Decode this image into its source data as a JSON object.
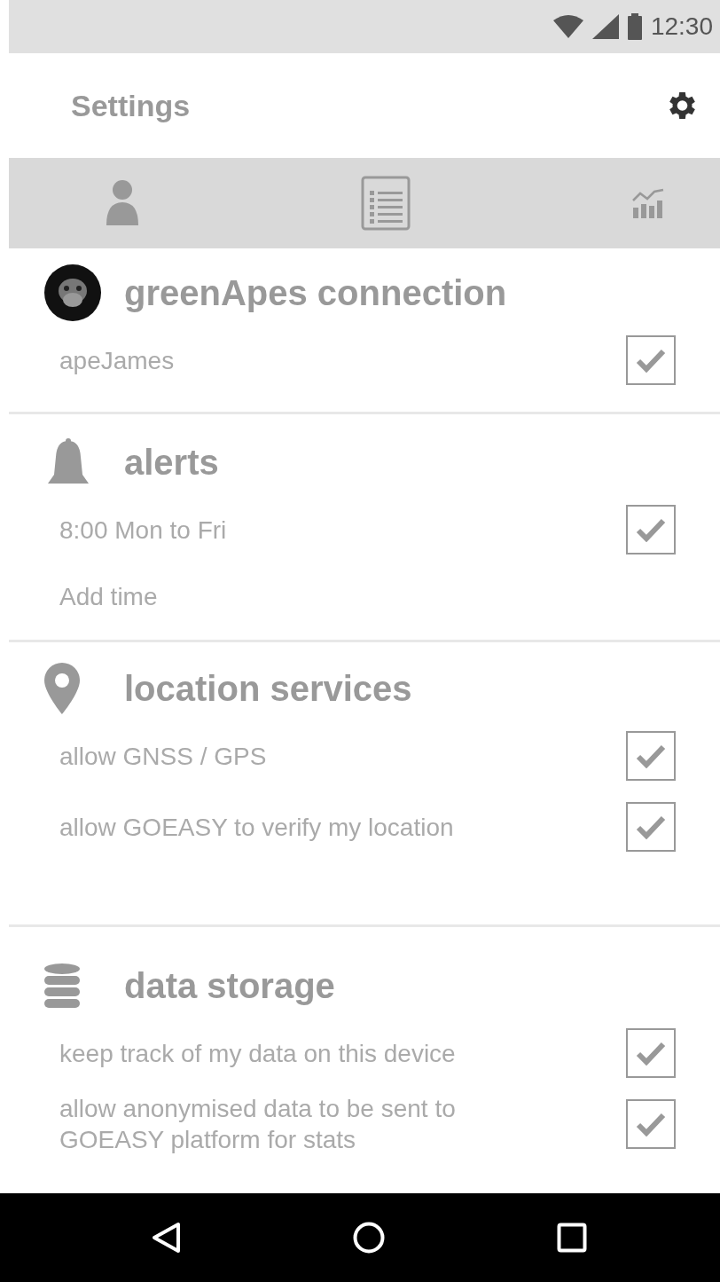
{
  "status_bar": {
    "time": "12:30"
  },
  "header": {
    "title": "Settings"
  },
  "sections": [
    {
      "title": "greenApes connection",
      "rows": [
        {
          "kind": "toggle",
          "text": "apeJames",
          "checked": true
        }
      ]
    },
    {
      "title": "alerts",
      "rows": [
        {
          "kind": "toggle",
          "text": "8:00 Mon to Fri",
          "checked": true
        },
        {
          "kind": "action",
          "text": "Add time"
        }
      ]
    },
    {
      "title": "location services",
      "rows": [
        {
          "kind": "toggle",
          "text": "allow GNSS / GPS",
          "checked": true
        },
        {
          "kind": "toggle",
          "text": "allow GOEASY to verify my location",
          "checked": true
        }
      ]
    },
    {
      "title": "data storage",
      "rows": [
        {
          "kind": "toggle",
          "text": "keep track of my data on this device",
          "checked": true
        },
        {
          "kind": "toggle",
          "text": "allow anonymised data to be sent to GOEASY platform for stats",
          "checked": true
        }
      ]
    }
  ]
}
